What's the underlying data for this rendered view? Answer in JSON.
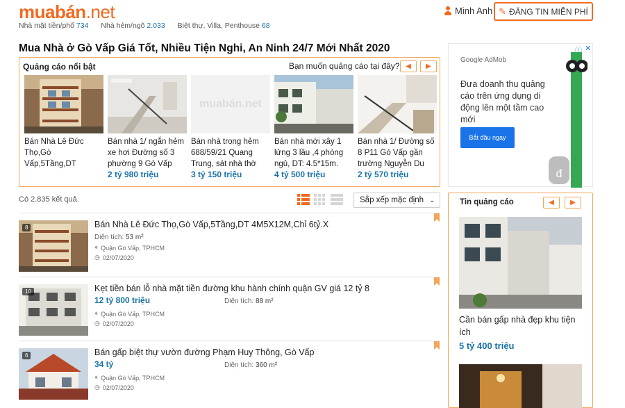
{
  "header": {
    "logo_brand": "muabán",
    "logo_tld": ".net",
    "user_name": "Minh Anh",
    "post_button": "ĐĂNG TIN MIỄN PHÍ"
  },
  "subnav": [
    {
      "label": "Nhà mặt tiền/phố",
      "count": "734"
    },
    {
      "label": "Nhà hẻm/ngõ",
      "count": "2.033"
    },
    {
      "label": "Biệt thự, Villa, Penthouse",
      "count": "68"
    }
  ],
  "page_title": "Mua Nhà ở Gò Vấp Giá Tốt, Nhiều Tiện Nghi, An Ninh 24/7 Mới Nhất 2020",
  "featured": {
    "heading": "Quảng cáo nổi bật",
    "ask": "Bạn muốn quảng cáo tại đây?",
    "cards": [
      {
        "text": "Bán Nhà Lê Đức Thọ,Gò Vấp,5Tầng,DT",
        "price": ""
      },
      {
        "text": "Bán nhà 1/ ngắn hẻm xe hơi Đường số 3 phường 9 Gò Vấp",
        "price": "2 tỷ 980 triệu"
      },
      {
        "text": "Bán nhà trong hẻm 688/59/21 Quang Trung, sát nhà thờ",
        "price": "3 tỷ 150 triệu"
      },
      {
        "text": "Bán nhà mới xây 1 lửng 3 lầu ,4 phòng ngủ, DT: 4.5*15m.",
        "price": "4 tỷ 500 triệu"
      },
      {
        "text": "Bán nhà 1/ Đường số 8 P11 Gò Vấp gần trường Nguyễn Du",
        "price": "2 tỷ 570 triệu"
      }
    ]
  },
  "results": {
    "count_text": "Có 2.835 kết quả.",
    "sort_label": "Sắp xếp mặc định"
  },
  "listings": [
    {
      "badge": "8",
      "title": "Bán Nhà Lê Đức Thọ,Gò Vấp,5Tầng,DT 4M5X12M,Chỉ 6tỷ.X",
      "price": "",
      "area_label": "Diện tích:",
      "area_value": "53 m²",
      "location": "Quận Gò Vấp, TPHCM",
      "date": "02/07/2020"
    },
    {
      "badge": "10",
      "title": "Kẹt tiền bán lỗ nhà mặt tiền đường khu hành chính quận GV giá 12 tỷ 8",
      "price": "12 tỷ 800 triệu",
      "area_label": "Diện tích:",
      "area_value": "88 m²",
      "location": "Quận Gò Vấp, TPHCM",
      "date": "02/07/2020"
    },
    {
      "badge": "6",
      "title": "Bán gấp biệt thự vườn đường Phạm Huy Thông, Gò Vấp",
      "price": "34 tỷ",
      "area_label": "Diện tích:",
      "area_value": "360 m²",
      "location": "Quận Gò Vấp, TPHCM",
      "date": "02/07/2020"
    }
  ],
  "admob": {
    "logo": "Google AdMob",
    "text": "Đưa doanh thu quảng cáo trên ứng dụng di động lên một tầm cao mới",
    "button": "Bắt đầu ngay"
  },
  "tin_quang_cao": {
    "heading": "Tin quảng cáo",
    "text": "Cần bán gấp nhà đẹp khu tiện ích",
    "price": "5 tỷ 400 triệu"
  },
  "colors": {
    "accent": "#f26a21",
    "price": "#1a73a8",
    "border": "#f2a65a"
  },
  "icons": [
    "user-icon",
    "pencil-icon",
    "chevron-left-icon",
    "chevron-right-icon",
    "list-view-icon",
    "grid-view-icon",
    "rows-view-icon",
    "location-icon",
    "clock-icon",
    "bookmark-icon"
  ]
}
